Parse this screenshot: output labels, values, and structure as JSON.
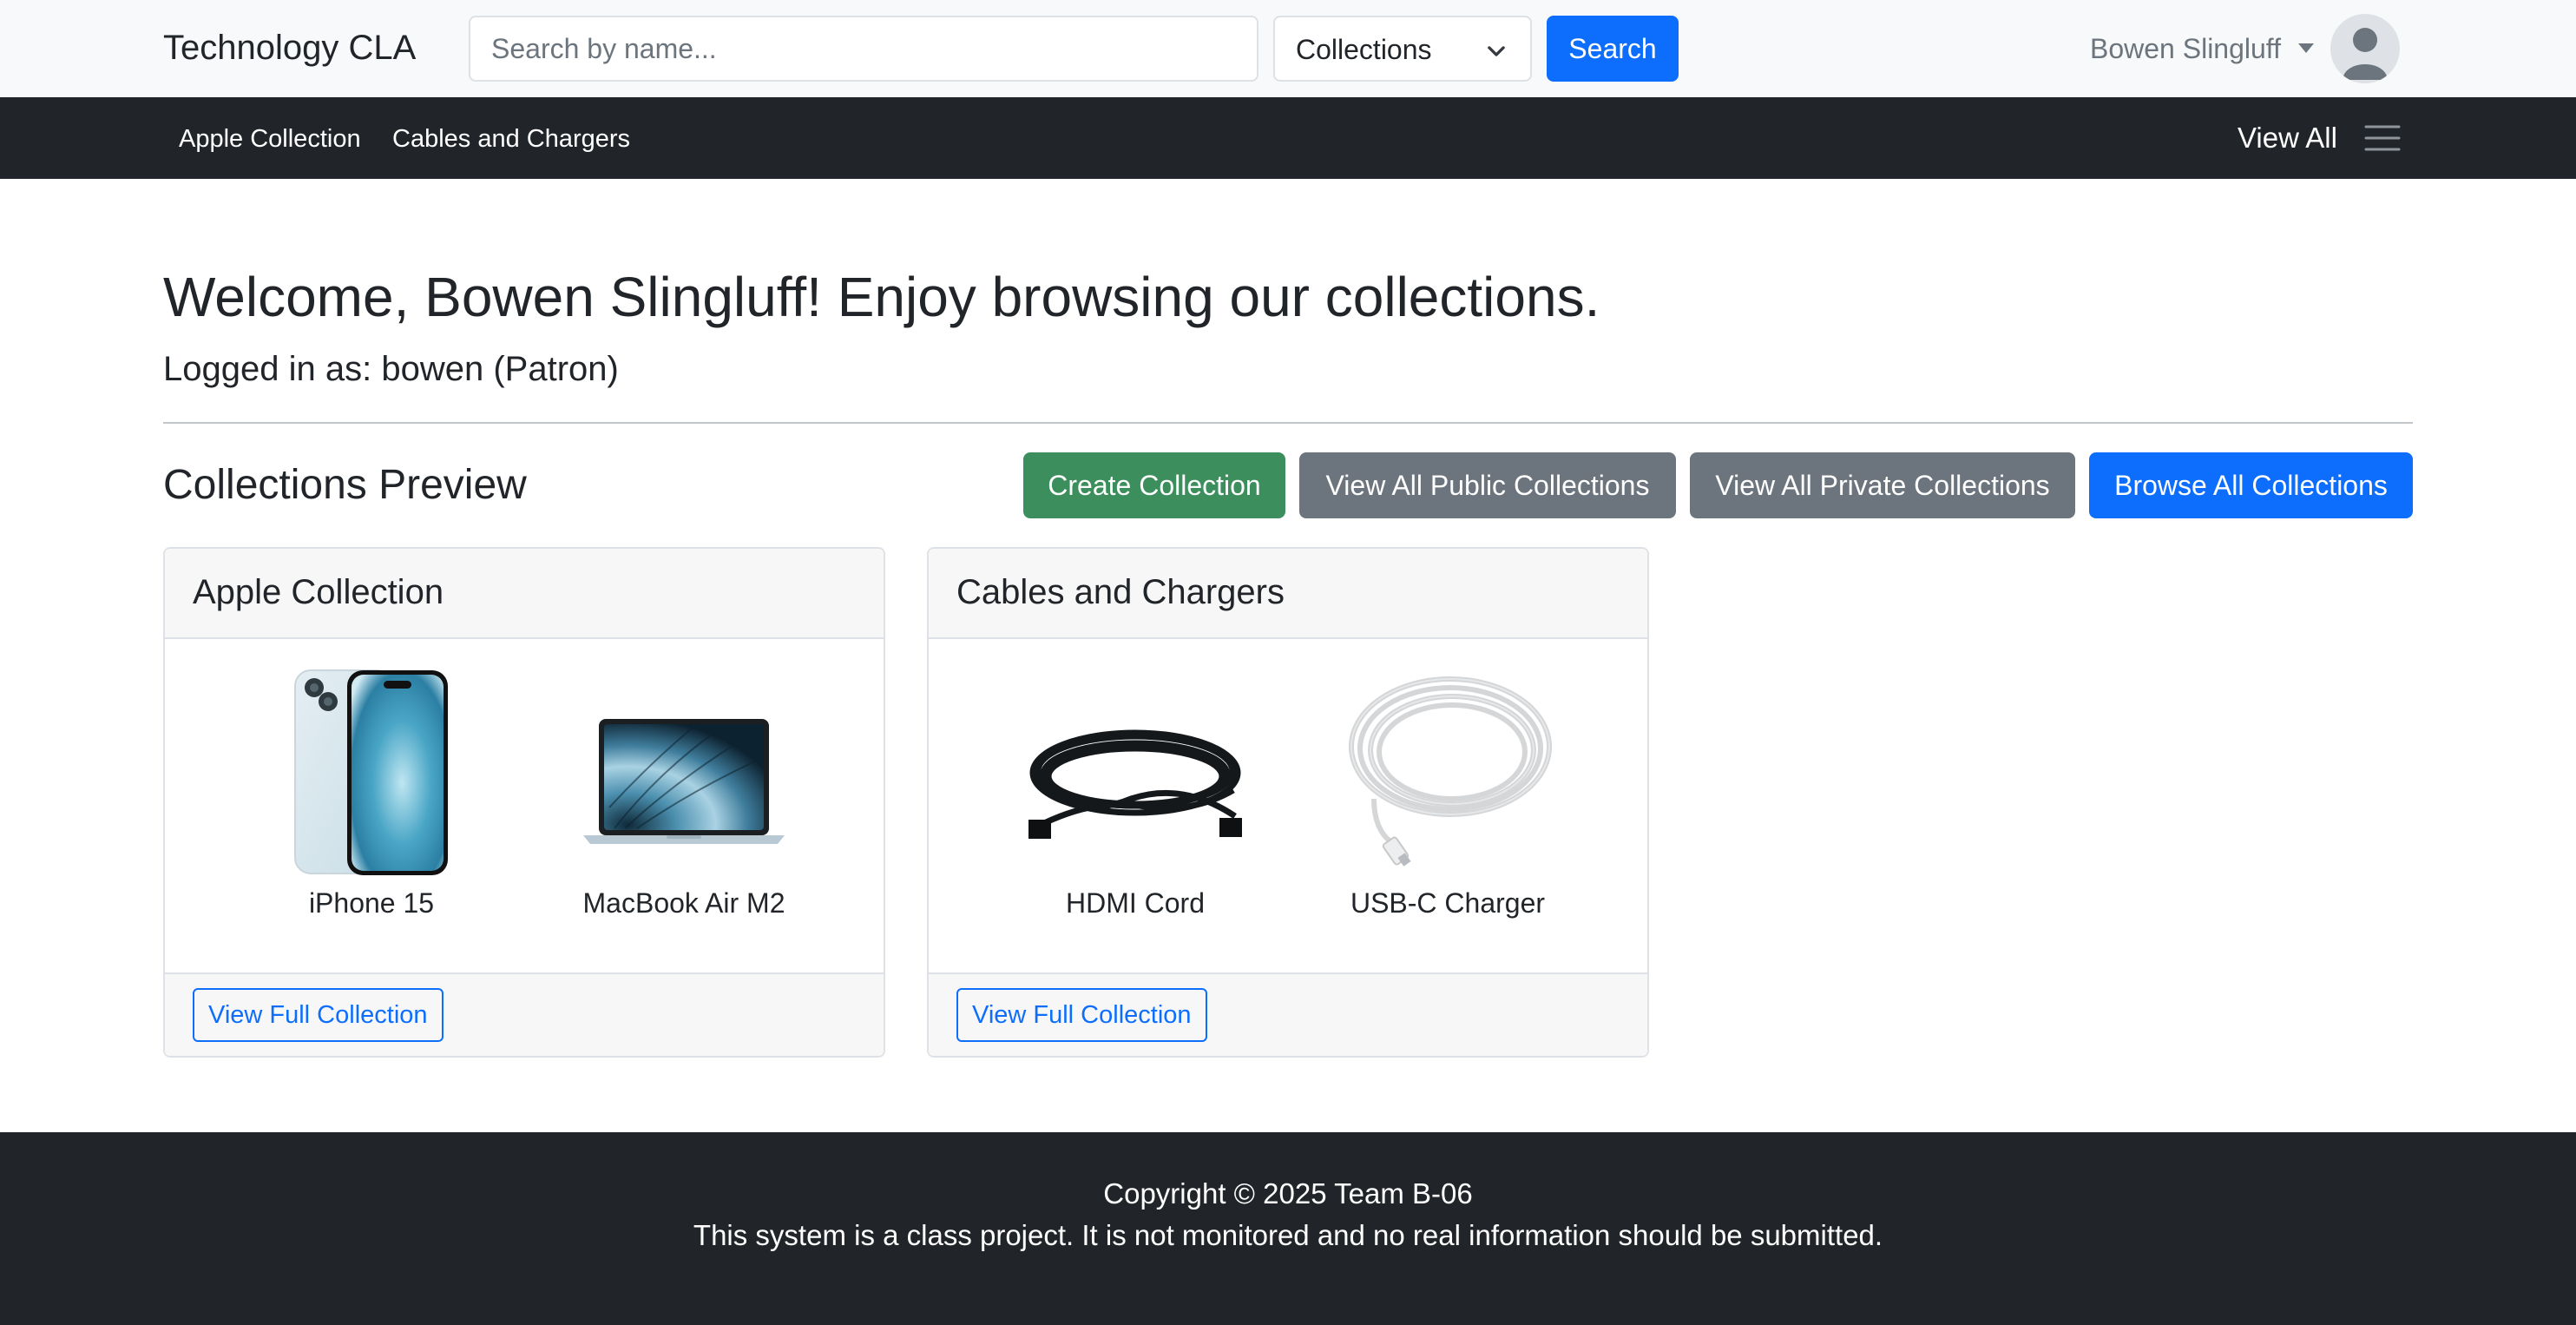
{
  "header": {
    "brand": "Technology CLA",
    "search_placeholder": "Search by name...",
    "search_scope": "Collections",
    "search_button": "Search",
    "user_name": "Bowen Slingluff"
  },
  "subnav": {
    "links": [
      "Apple Collection",
      "Cables and Chargers"
    ],
    "view_all": "View All"
  },
  "main": {
    "welcome": "Welcome, Bowen Slingluff! Enjoy browsing our collections.",
    "logged_in_prefix": "Logged in as:",
    "logged_in_user": "bowen",
    "logged_in_role": "(Patron)",
    "preview_title": "Collections Preview",
    "buttons": {
      "create": "Create Collection",
      "public": "View All Public Collections",
      "private": "View All Private Collections",
      "browse": "Browse All Collections"
    },
    "collections": [
      {
        "title": "Apple Collection",
        "items": [
          "iPhone 15",
          "MacBook Air M2"
        ],
        "footer_button": "View Full Collection"
      },
      {
        "title": "Cables and Chargers",
        "items": [
          "HDMI Cord",
          "USB-C Charger"
        ],
        "footer_button": "View Full Collection"
      }
    ]
  },
  "footer": {
    "copyright": "Copyright © 2025 Team B-06",
    "disclaimer": "This system is a class project. It is not monitored and no real information should be submitted."
  },
  "colors": {
    "primary": "#0d6efd",
    "success": "#3c8f5d",
    "secondary": "#6c757d",
    "dark": "#212529",
    "light": "#f8f9fa"
  }
}
